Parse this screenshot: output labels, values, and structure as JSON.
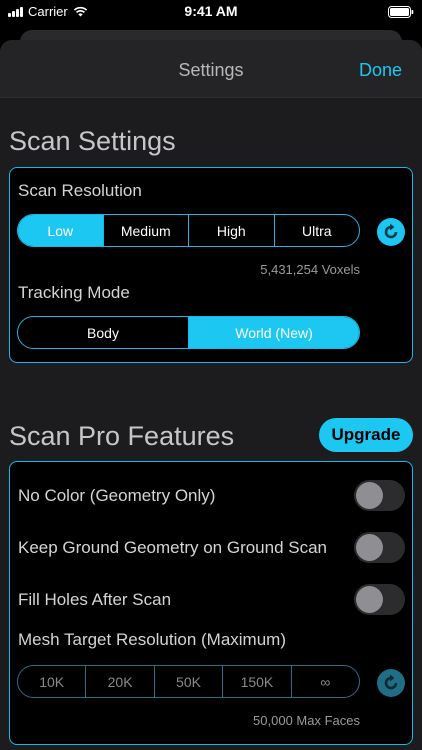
{
  "status": {
    "carrier": "Carrier",
    "time": "9:41 AM"
  },
  "nav": {
    "title": "Settings",
    "done": "Done"
  },
  "scan_settings": {
    "title": "Scan Settings",
    "resolution_label": "Scan Resolution",
    "resolution_options": [
      "Low",
      "Medium",
      "High",
      "Ultra"
    ],
    "resolution_selected": "Low",
    "voxels": "5,431,254 Voxels",
    "tracking_label": "Tracking Mode",
    "tracking_options": [
      "Body",
      "World (New)"
    ],
    "tracking_selected": "World (New)"
  },
  "pro": {
    "title": "Scan Pro Features",
    "upgrade": "Upgrade",
    "toggles": [
      {
        "label": "No Color (Geometry Only)",
        "on": false
      },
      {
        "label": "Keep Ground Geometry on Ground Scan",
        "on": false
      },
      {
        "label": "Fill Holes After Scan",
        "on": false
      }
    ],
    "mesh_label": "Mesh Target Resolution (Maximum)",
    "mesh_options": [
      "10K",
      "20K",
      "50K",
      "150K",
      "∞"
    ],
    "max_faces": "50,000 Max Faces"
  },
  "colors": {
    "accent": "#1cc8f2",
    "panel_border": "#19b7e6",
    "background": "#000000"
  }
}
